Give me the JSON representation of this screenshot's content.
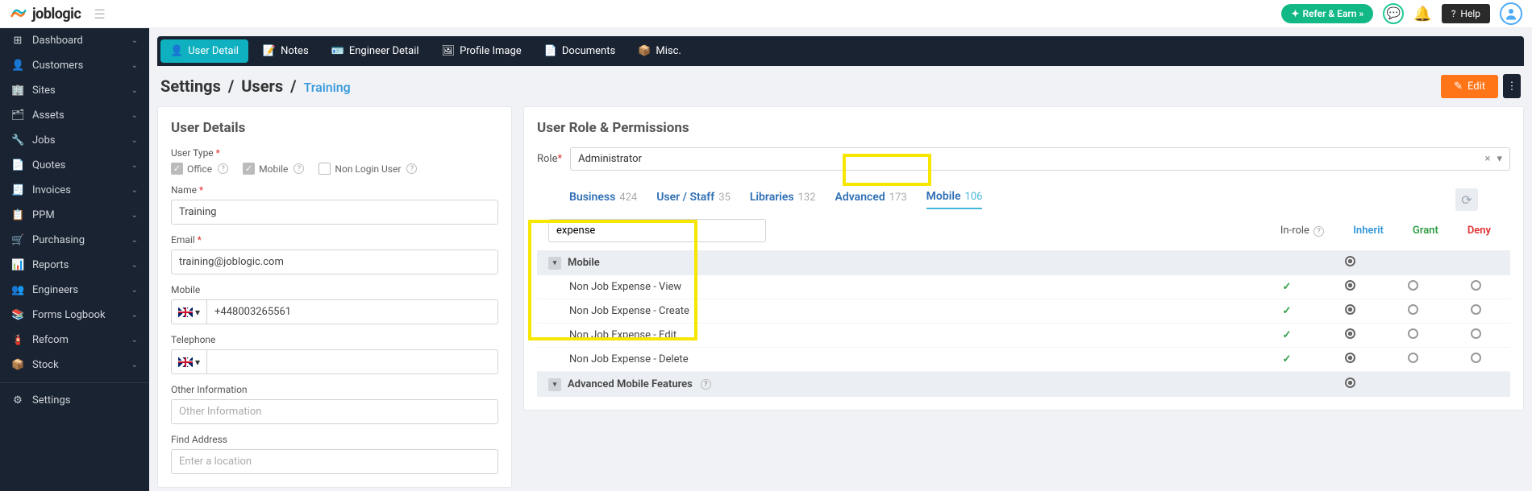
{
  "header": {
    "brand": "joblogic",
    "refer_label": "Refer & Earn »",
    "help_label": "Help"
  },
  "sidebar": {
    "items": [
      {
        "icon": "⊞",
        "label": "Dashboard"
      },
      {
        "icon": "👤",
        "label": "Customers"
      },
      {
        "icon": "🏢",
        "label": "Sites"
      },
      {
        "icon": "🗂",
        "label": "Assets"
      },
      {
        "icon": "🔧",
        "label": "Jobs"
      },
      {
        "icon": "📄",
        "label": "Quotes"
      },
      {
        "icon": "🧾",
        "label": "Invoices"
      },
      {
        "icon": "📋",
        "label": "PPM"
      },
      {
        "icon": "🛒",
        "label": "Purchasing"
      },
      {
        "icon": "📊",
        "label": "Reports"
      },
      {
        "icon": "👥",
        "label": "Engineers"
      },
      {
        "icon": "📚",
        "label": "Forms Logbook"
      },
      {
        "icon": "🧯",
        "label": "Refcom"
      },
      {
        "icon": "📦",
        "label": "Stock"
      }
    ],
    "settings_label": "Settings"
  },
  "tabs": [
    {
      "icon": "👤",
      "label": "User Detail",
      "active": true
    },
    {
      "icon": "📝",
      "label": "Notes"
    },
    {
      "icon": "🪪",
      "label": "Engineer Detail"
    },
    {
      "icon": "🖼",
      "label": "Profile Image"
    },
    {
      "icon": "📄",
      "label": "Documents"
    },
    {
      "icon": "📦",
      "label": "Misc."
    }
  ],
  "breadcrumb": {
    "root": "Settings",
    "parent": "Users",
    "current": "Training",
    "edit_label": "Edit"
  },
  "user_details": {
    "title": "User Details",
    "user_type_label": "User Type",
    "office_label": "Office",
    "mobile_label": "Mobile",
    "nonlogin_label": "Non Login User",
    "name_label": "Name",
    "name_value": "Training",
    "email_label": "Email",
    "email_value": "training@joblogic.com",
    "mobile_field_label": "Mobile",
    "mobile_value": "+448003265561",
    "telephone_label": "Telephone",
    "telephone_value": "",
    "other_info_label": "Other Information",
    "other_info_placeholder": "Other Information",
    "find_address_label": "Find Address",
    "find_address_placeholder": "Enter a location"
  },
  "permissions": {
    "title": "User Role & Permissions",
    "role_label": "Role",
    "role_value": "Administrator",
    "tabs": [
      {
        "label": "Business",
        "count": "424"
      },
      {
        "label": "User / Staff",
        "count": "35"
      },
      {
        "label": "Libraries",
        "count": "132"
      },
      {
        "label": "Advanced",
        "count": "173"
      },
      {
        "label": "Mobile",
        "count": "106",
        "active": true
      }
    ],
    "search_value": "expense",
    "col_inrole": "In-role",
    "col_inherit": "Inherit",
    "col_grant": "Grant",
    "col_deny": "Deny",
    "groups": [
      {
        "name": "Mobile",
        "rows": [
          {
            "name": "Non Job Expense - View",
            "inrole": true
          },
          {
            "name": "Non Job Expense - Create",
            "inrole": true
          },
          {
            "name": "Non Job Expense - Edit",
            "inrole": true
          },
          {
            "name": "Non Job Expense - Delete",
            "inrole": true
          }
        ]
      },
      {
        "name": "Advanced Mobile Features",
        "rows": []
      }
    ]
  }
}
